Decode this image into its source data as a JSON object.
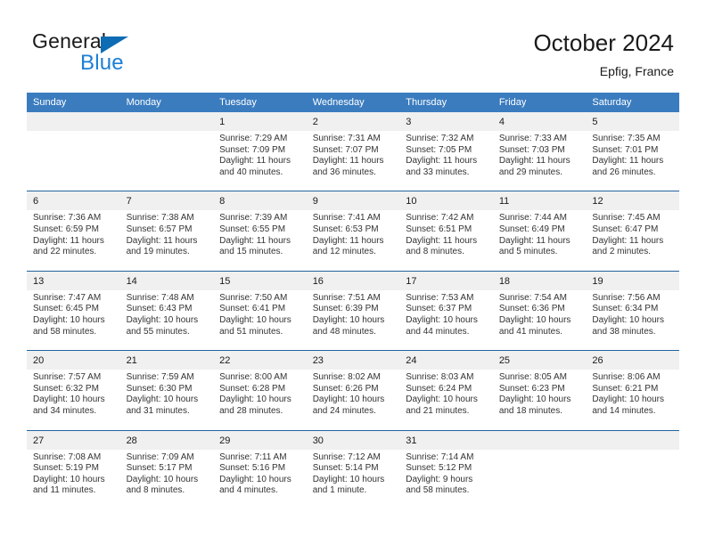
{
  "brand": {
    "name_part1": "General",
    "name_part2": "Blue",
    "triangle_color": "#0d6cb3",
    "blue_color": "#1b7fd4"
  },
  "header": {
    "title": "October 2024",
    "subtitle": "Epfig, France"
  },
  "theme": {
    "header_blue": "#3b7cbf",
    "row_divider_blue": "#24649f",
    "date_band_gray": "#f0f0f0",
    "text_color": "#1a1a1a"
  },
  "calendar": {
    "weekdays": [
      "Sunday",
      "Monday",
      "Tuesday",
      "Wednesday",
      "Thursday",
      "Friday",
      "Saturday"
    ],
    "weeks": [
      {
        "dates": [
          "",
          "",
          "1",
          "2",
          "3",
          "4",
          "5"
        ],
        "cells": [
          {
            "empty": true,
            "lines": []
          },
          {
            "empty": true,
            "lines": []
          },
          {
            "empty": false,
            "lines": [
              "Sunrise: 7:29 AM",
              "Sunset: 7:09 PM",
              "Daylight: 11 hours",
              "and 40 minutes."
            ]
          },
          {
            "empty": false,
            "lines": [
              "Sunrise: 7:31 AM",
              "Sunset: 7:07 PM",
              "Daylight: 11 hours",
              "and 36 minutes."
            ]
          },
          {
            "empty": false,
            "lines": [
              "Sunrise: 7:32 AM",
              "Sunset: 7:05 PM",
              "Daylight: 11 hours",
              "and 33 minutes."
            ]
          },
          {
            "empty": false,
            "lines": [
              "Sunrise: 7:33 AM",
              "Sunset: 7:03 PM",
              "Daylight: 11 hours",
              "and 29 minutes."
            ]
          },
          {
            "empty": false,
            "lines": [
              "Sunrise: 7:35 AM",
              "Sunset: 7:01 PM",
              "Daylight: 11 hours",
              "and 26 minutes."
            ]
          }
        ]
      },
      {
        "dates": [
          "6",
          "7",
          "8",
          "9",
          "10",
          "11",
          "12"
        ],
        "cells": [
          {
            "empty": false,
            "lines": [
              "Sunrise: 7:36 AM",
              "Sunset: 6:59 PM",
              "Daylight: 11 hours",
              "and 22 minutes."
            ]
          },
          {
            "empty": false,
            "lines": [
              "Sunrise: 7:38 AM",
              "Sunset: 6:57 PM",
              "Daylight: 11 hours",
              "and 19 minutes."
            ]
          },
          {
            "empty": false,
            "lines": [
              "Sunrise: 7:39 AM",
              "Sunset: 6:55 PM",
              "Daylight: 11 hours",
              "and 15 minutes."
            ]
          },
          {
            "empty": false,
            "lines": [
              "Sunrise: 7:41 AM",
              "Sunset: 6:53 PM",
              "Daylight: 11 hours",
              "and 12 minutes."
            ]
          },
          {
            "empty": false,
            "lines": [
              "Sunrise: 7:42 AM",
              "Sunset: 6:51 PM",
              "Daylight: 11 hours",
              "and 8 minutes."
            ]
          },
          {
            "empty": false,
            "lines": [
              "Sunrise: 7:44 AM",
              "Sunset: 6:49 PM",
              "Daylight: 11 hours",
              "and 5 minutes."
            ]
          },
          {
            "empty": false,
            "lines": [
              "Sunrise: 7:45 AM",
              "Sunset: 6:47 PM",
              "Daylight: 11 hours",
              "and 2 minutes."
            ]
          }
        ]
      },
      {
        "dates": [
          "13",
          "14",
          "15",
          "16",
          "17",
          "18",
          "19"
        ],
        "cells": [
          {
            "empty": false,
            "lines": [
              "Sunrise: 7:47 AM",
              "Sunset: 6:45 PM",
              "Daylight: 10 hours",
              "and 58 minutes."
            ]
          },
          {
            "empty": false,
            "lines": [
              "Sunrise: 7:48 AM",
              "Sunset: 6:43 PM",
              "Daylight: 10 hours",
              "and 55 minutes."
            ]
          },
          {
            "empty": false,
            "lines": [
              "Sunrise: 7:50 AM",
              "Sunset: 6:41 PM",
              "Daylight: 10 hours",
              "and 51 minutes."
            ]
          },
          {
            "empty": false,
            "lines": [
              "Sunrise: 7:51 AM",
              "Sunset: 6:39 PM",
              "Daylight: 10 hours",
              "and 48 minutes."
            ]
          },
          {
            "empty": false,
            "lines": [
              "Sunrise: 7:53 AM",
              "Sunset: 6:37 PM",
              "Daylight: 10 hours",
              "and 44 minutes."
            ]
          },
          {
            "empty": false,
            "lines": [
              "Sunrise: 7:54 AM",
              "Sunset: 6:36 PM",
              "Daylight: 10 hours",
              "and 41 minutes."
            ]
          },
          {
            "empty": false,
            "lines": [
              "Sunrise: 7:56 AM",
              "Sunset: 6:34 PM",
              "Daylight: 10 hours",
              "and 38 minutes."
            ]
          }
        ]
      },
      {
        "dates": [
          "20",
          "21",
          "22",
          "23",
          "24",
          "25",
          "26"
        ],
        "cells": [
          {
            "empty": false,
            "lines": [
              "Sunrise: 7:57 AM",
              "Sunset: 6:32 PM",
              "Daylight: 10 hours",
              "and 34 minutes."
            ]
          },
          {
            "empty": false,
            "lines": [
              "Sunrise: 7:59 AM",
              "Sunset: 6:30 PM",
              "Daylight: 10 hours",
              "and 31 minutes."
            ]
          },
          {
            "empty": false,
            "lines": [
              "Sunrise: 8:00 AM",
              "Sunset: 6:28 PM",
              "Daylight: 10 hours",
              "and 28 minutes."
            ]
          },
          {
            "empty": false,
            "lines": [
              "Sunrise: 8:02 AM",
              "Sunset: 6:26 PM",
              "Daylight: 10 hours",
              "and 24 minutes."
            ]
          },
          {
            "empty": false,
            "lines": [
              "Sunrise: 8:03 AM",
              "Sunset: 6:24 PM",
              "Daylight: 10 hours",
              "and 21 minutes."
            ]
          },
          {
            "empty": false,
            "lines": [
              "Sunrise: 8:05 AM",
              "Sunset: 6:23 PM",
              "Daylight: 10 hours",
              "and 18 minutes."
            ]
          },
          {
            "empty": false,
            "lines": [
              "Sunrise: 8:06 AM",
              "Sunset: 6:21 PM",
              "Daylight: 10 hours",
              "and 14 minutes."
            ]
          }
        ]
      },
      {
        "dates": [
          "27",
          "28",
          "29",
          "30",
          "31",
          "",
          ""
        ],
        "cells": [
          {
            "empty": false,
            "lines": [
              "Sunrise: 7:08 AM",
              "Sunset: 5:19 PM",
              "Daylight: 10 hours",
              "and 11 minutes."
            ]
          },
          {
            "empty": false,
            "lines": [
              "Sunrise: 7:09 AM",
              "Sunset: 5:17 PM",
              "Daylight: 10 hours",
              "and 8 minutes."
            ]
          },
          {
            "empty": false,
            "lines": [
              "Sunrise: 7:11 AM",
              "Sunset: 5:16 PM",
              "Daylight: 10 hours",
              "and 4 minutes."
            ]
          },
          {
            "empty": false,
            "lines": [
              "Sunrise: 7:12 AM",
              "Sunset: 5:14 PM",
              "Daylight: 10 hours",
              "and 1 minute."
            ]
          },
          {
            "empty": false,
            "lines": [
              "Sunrise: 7:14 AM",
              "Sunset: 5:12 PM",
              "Daylight: 9 hours",
              "and 58 minutes."
            ]
          },
          {
            "empty": true,
            "lines": []
          },
          {
            "empty": true,
            "lines": []
          }
        ]
      }
    ]
  }
}
